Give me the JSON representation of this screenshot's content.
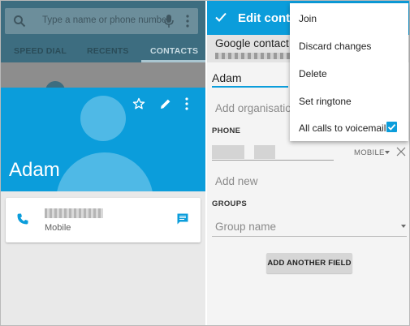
{
  "left_panel": {
    "search": {
      "placeholder": "Type a name or phone number"
    },
    "tabs": [
      {
        "label": "SPEED DIAL"
      },
      {
        "label": "RECENTS"
      },
      {
        "label": "CONTACTS"
      }
    ],
    "contact": {
      "name": "Adam",
      "phone_type": "Mobile"
    },
    "icons": [
      "search-icon",
      "mic-icon",
      "more-vert-icon",
      "star-icon",
      "edit-icon",
      "phone-icon",
      "message-icon"
    ]
  },
  "right_panel": {
    "toolbar": {
      "title": "Edit conta"
    },
    "account_label": "Google contact",
    "name_value": "Adam",
    "organisation_placeholder": "Add organisation",
    "phone_section": "PHONE",
    "phone_type": "MOBILE",
    "add_new": "Add new",
    "groups_section": "GROUPS",
    "group_placeholder": "Group name",
    "add_field_button": "ADD ANOTHER FIELD"
  },
  "menu": {
    "items": [
      {
        "label": "Join"
      },
      {
        "label": "Discard changes"
      },
      {
        "label": "Delete"
      },
      {
        "label": "Set ringtone"
      },
      {
        "label": "All calls to voicemail"
      }
    ],
    "voicemail_checked": true
  },
  "colors": {
    "primary": "#0b9ddb",
    "dim_toolbar": "#3d6d80"
  }
}
